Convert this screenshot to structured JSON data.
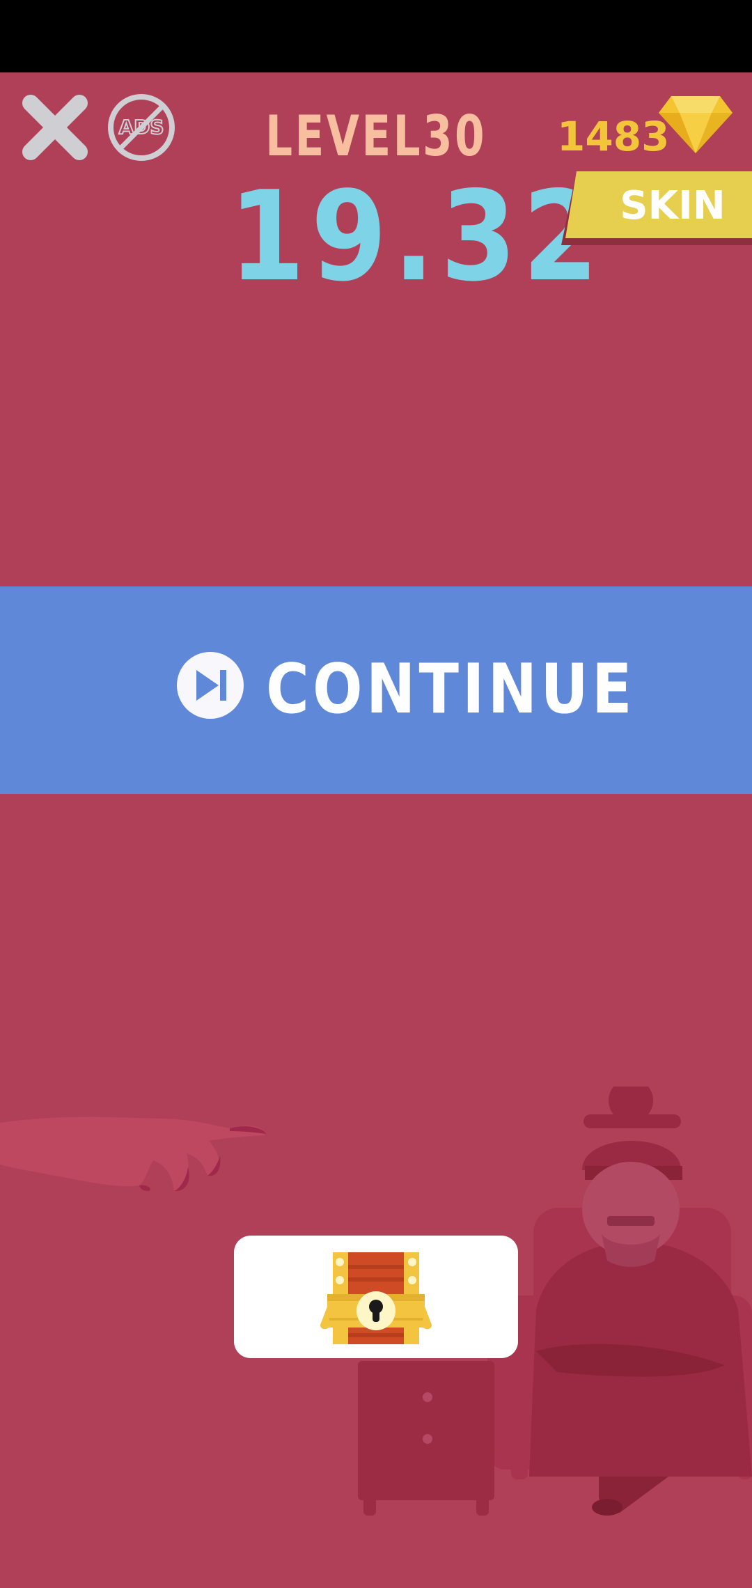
{
  "hud": {
    "level_label": "LEVEL30",
    "timer": "19.32",
    "gems": "1483",
    "skin_label": "SKIN"
  },
  "actions": {
    "continue_label": "CONTINUE"
  },
  "icons": {
    "close": "close-icon",
    "no_ads": "no-ads-icon",
    "gem": "gem-icon",
    "play": "play-skip-icon",
    "chest": "treasure-chest-icon"
  },
  "colors": {
    "background": "#b04058",
    "continue": "#5f89d8",
    "timer": "#7ed3e6",
    "level": "#f7bfa0",
    "gem": "#f3c53a",
    "skin": "#e6cf4f"
  }
}
